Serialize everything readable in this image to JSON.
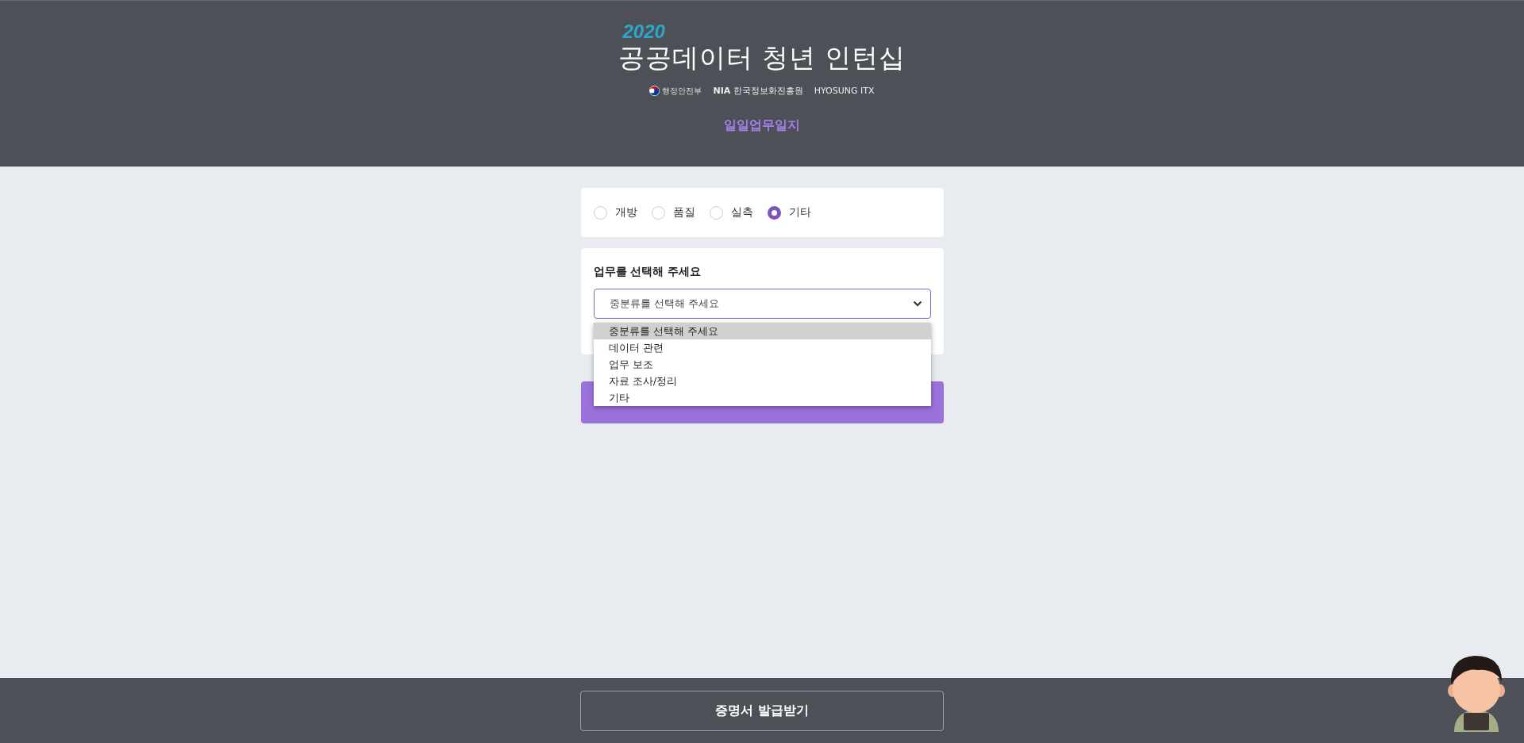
{
  "header": {
    "year": "2020",
    "title": "공공데이터 청년 인턴십",
    "sponsors": [
      {
        "kind": "emblem",
        "label": "행정안전부"
      },
      {
        "kind": "text",
        "label": "**NIA** 한국정보화진흥원"
      },
      {
        "kind": "text",
        "label": "HYOSUNG ITX"
      }
    ],
    "subtitle": "일일업무일지"
  },
  "categories": [
    {
      "label": "개방",
      "selected": false
    },
    {
      "label": "품질",
      "selected": false
    },
    {
      "label": "실측",
      "selected": false
    },
    {
      "label": "기타",
      "selected": true
    }
  ],
  "task": {
    "label": "업무를 선택해 주세요",
    "select_value": "중분류를 선택해 주세요",
    "expanded": true,
    "options": [
      {
        "label": "중분류를 선택해 주세요",
        "selected": true
      },
      {
        "label": "데이터 관련",
        "selected": false
      },
      {
        "label": "업무 보조",
        "selected": false
      },
      {
        "label": "자료 조사/정리",
        "selected": false
      },
      {
        "label": "기타",
        "selected": false
      }
    ]
  },
  "footer": {
    "button": "증명서 발급받기"
  }
}
